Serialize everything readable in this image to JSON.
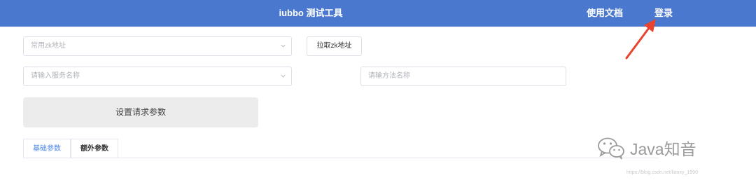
{
  "header": {
    "title": "iubbo 测试工具",
    "nav_docs": "使用文档",
    "nav_login": "登录"
  },
  "form": {
    "zk_select_placeholder": "常用zk地址",
    "pull_zk_button": "拉取zk地址",
    "service_select_placeholder": "请输入服务名称",
    "method_input_placeholder": "请输方法名称",
    "set_params_button": "设置请求参数"
  },
  "tabs": [
    {
      "label": "基础参数",
      "active": true
    },
    {
      "label": "额外参数",
      "active": false
    }
  ],
  "watermark": {
    "text": "Java知音",
    "url": "https://blog.csdn.net/lianxy_1990"
  },
  "colors": {
    "header_bg": "#4a78cf",
    "active_tab": "#4a86e8",
    "arrow": "#e8432e"
  },
  "icons": {
    "select_chevron": "chevron-down-icon",
    "annotation_arrow": "red-arrow-icon",
    "watermark_logo": "wechat-icon"
  }
}
